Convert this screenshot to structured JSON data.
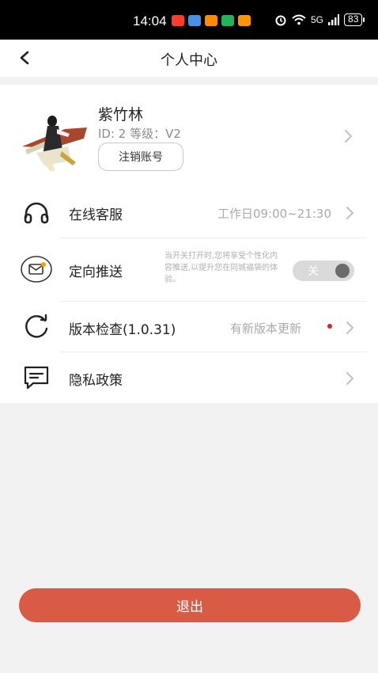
{
  "status_bar": {
    "time": "14:04",
    "network": "5G",
    "battery": "83",
    "app_icon_colors": [
      "#ff3b30",
      "#4a90e2",
      "#ff8a00",
      "#21b45a",
      "#ff9500"
    ]
  },
  "header": {
    "title": "个人中心",
    "back_icon": "chevron-left-icon"
  },
  "profile": {
    "name": "紫竹林",
    "id_level": "ID: 2 等级：V2",
    "cancel_account_label": "注销账号"
  },
  "menu": {
    "customer_service": {
      "label": "在线客服",
      "value": "工作日09:00~21:30",
      "icon": "headset-icon"
    },
    "targeted_push": {
      "label": "定向推送",
      "description": "当开关打开时,您将享受个性化内容推送,以提升您在同城福袋的体验。",
      "toggle_label": "关",
      "toggle_on": false,
      "icon": "mail-icon"
    },
    "version_check": {
      "label": "版本检查(1.0.31)",
      "value": "有新版本更新",
      "icon": "refresh-icon"
    },
    "privacy_policy": {
      "label": "隐私政策",
      "icon": "message-icon"
    }
  },
  "logout_label": "退出",
  "colors": {
    "accent": "#d95a45",
    "badge": "#e02020"
  }
}
